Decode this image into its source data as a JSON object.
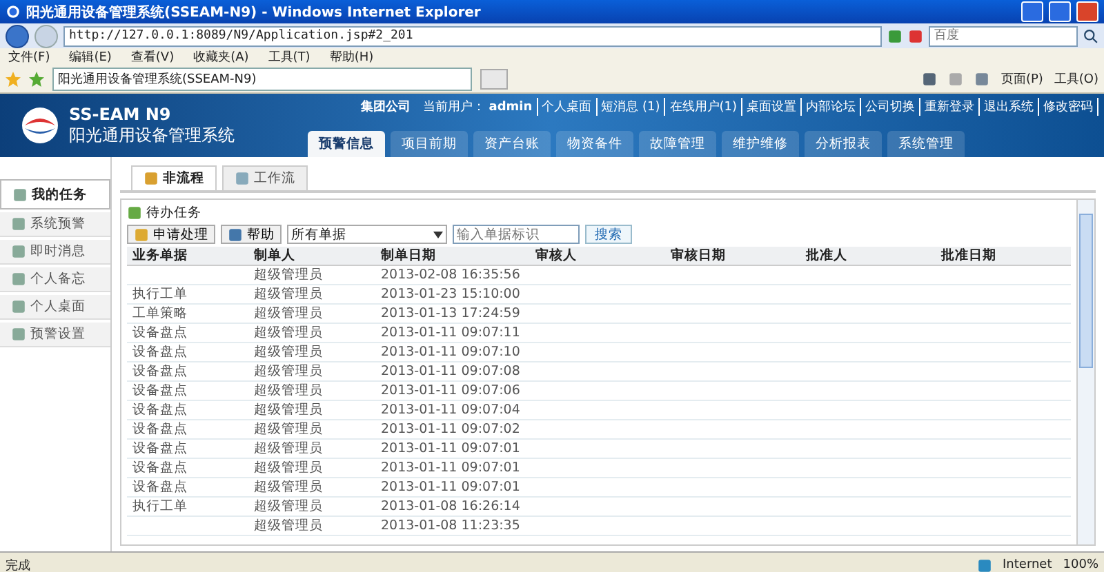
{
  "window": {
    "title": "阳光通用设备管理系统(SSEAM-N9) - Windows Internet Explorer"
  },
  "address_bar": {
    "url": "http://127.0.0.1:8089/N9/Application.jsp#2_201",
    "search_placeholder": "百度"
  },
  "menu_bar": [
    "文件(F)",
    "编辑(E)",
    "查看(V)",
    "收藏夹(A)",
    "工具(T)",
    "帮助(H)"
  ],
  "browser_tabs": [
    {
      "label": "阳光通用设备管理系统(SSEAM-N9)",
      "selected": true
    }
  ],
  "command_bar": [
    "页面(P)",
    "工具(O)"
  ],
  "app_header": {
    "logo_title": "SS-EAM N9",
    "logo_subtitle": "阳光通用设备管理系统",
    "company": "集团公司",
    "user_label": "当前用户：",
    "user": "admin",
    "links": [
      "个人桌面",
      "短消息 (1)",
      "在线用户(1)",
      "桌面设置",
      "内部论坛",
      "公司切换",
      "重新登录",
      "退出系统",
      "修改密码"
    ]
  },
  "main_tabs": [
    {
      "label": "预警信息",
      "selected": true
    },
    {
      "label": "项目前期",
      "selected": false
    },
    {
      "label": "资产台账",
      "selected": false
    },
    {
      "label": "物资备件",
      "selected": false
    },
    {
      "label": "故障管理",
      "selected": false
    },
    {
      "label": "维护维修",
      "selected": false
    },
    {
      "label": "分析报表",
      "selected": false
    },
    {
      "label": "系统管理",
      "selected": false
    }
  ],
  "sidebar": {
    "items": [
      {
        "label": "我的任务",
        "selected": true
      },
      {
        "label": "系统预警",
        "selected": false
      },
      {
        "label": "即时消息",
        "selected": false
      },
      {
        "label": "个人备忘",
        "selected": false
      },
      {
        "label": "个人桌面",
        "selected": false
      },
      {
        "label": "预警设置",
        "selected": false
      }
    ]
  },
  "content_tabs": [
    {
      "label": "非流程",
      "selected": true
    },
    {
      "label": "工作流",
      "selected": false
    }
  ],
  "panel": {
    "title": "待办任务",
    "buttons": [
      "申请处理",
      "帮助"
    ],
    "filter": "所有单据",
    "search_placeholder": "输入单据标识",
    "search_button": "搜索"
  },
  "table": {
    "columns": [
      "业务单据",
      "制单人",
      "制单日期",
      "审核人",
      "审核日期",
      "批准人",
      "批准日期"
    ],
    "rows": [
      [
        "",
        "超级管理员",
        "2013-02-08 16:35:56"
      ],
      [
        "执行工单",
        "超级管理员",
        "2013-01-23 15:10:00"
      ],
      [
        "工单策略",
        "超级管理员",
        "2013-01-13 17:24:59"
      ],
      [
        "设备盘点",
        "超级管理员",
        "2013-01-11 09:07:11"
      ],
      [
        "设备盘点",
        "超级管理员",
        "2013-01-11 09:07:10"
      ],
      [
        "设备盘点",
        "超级管理员",
        "2013-01-11 09:07:08"
      ],
      [
        "设备盘点",
        "超级管理员",
        "2013-01-11 09:07:06"
      ],
      [
        "设备盘点",
        "超级管理员",
        "2013-01-11 09:07:04"
      ],
      [
        "设备盘点",
        "超级管理员",
        "2013-01-11 09:07:02"
      ],
      [
        "设备盘点",
        "超级管理员",
        "2013-01-11 09:07:01"
      ],
      [
        "设备盘点",
        "超级管理员",
        "2013-01-11 09:07:01"
      ],
      [
        "设备盘点",
        "超级管理员",
        "2013-01-11 09:07:01"
      ],
      [
        "执行工单",
        "超级管理员",
        "2013-01-08 16:26:14"
      ],
      [
        "",
        "超级管理员",
        "2013-01-08 11:23:35"
      ]
    ]
  },
  "status_bar": {
    "text": "完成",
    "zone": "Internet",
    "zoom": "100%"
  }
}
